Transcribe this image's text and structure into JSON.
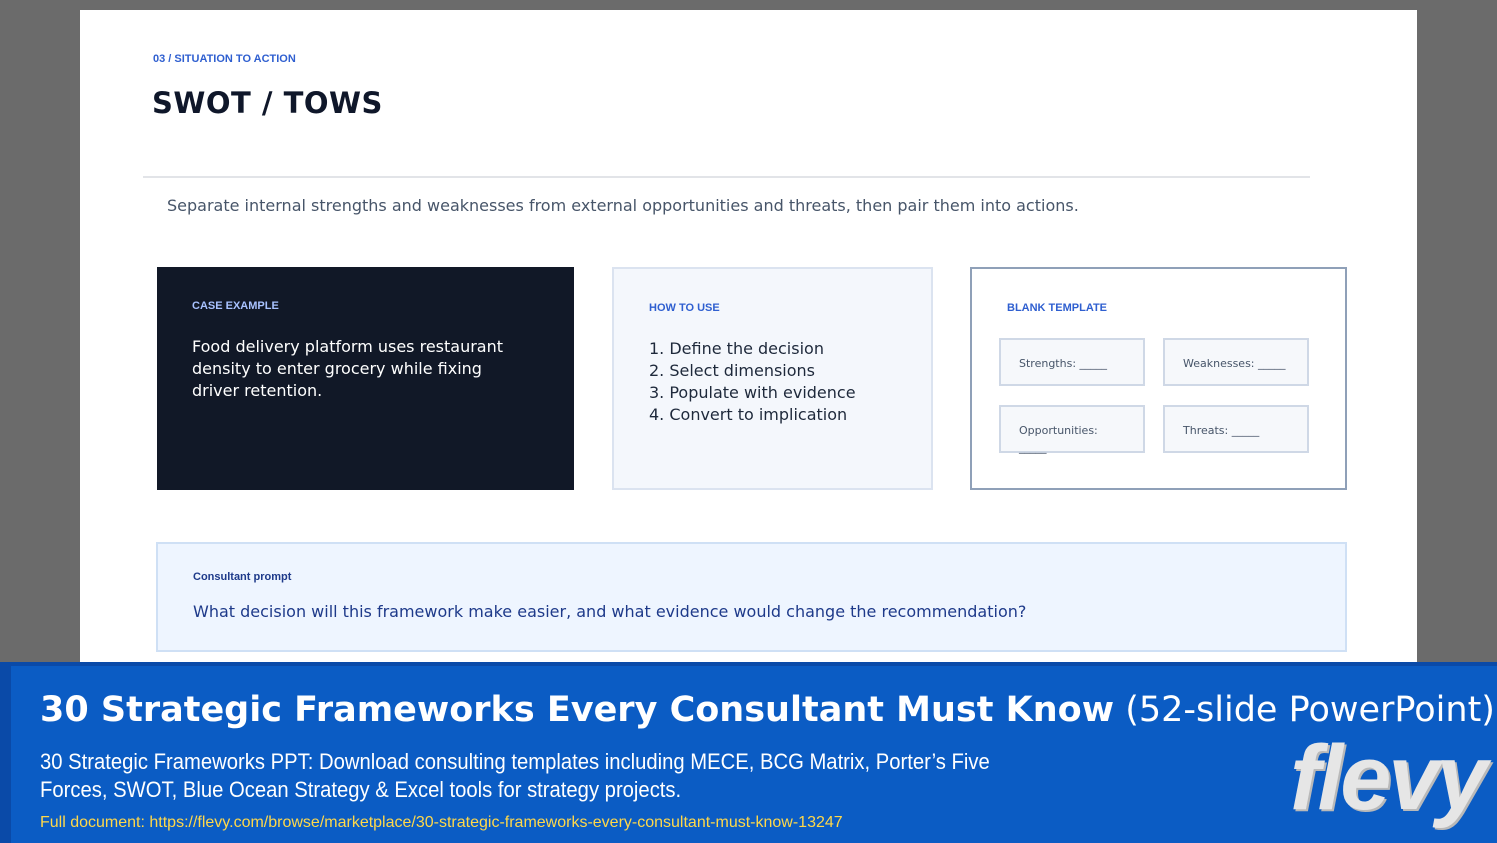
{
  "slide": {
    "kicker": "03 / SITUATION TO ACTION",
    "title": "SWOT / TOWS",
    "intro": "Separate internal strengths and weaknesses from external opportunities and threats, then pair them into actions.",
    "case": {
      "label": "CASE EXAMPLE",
      "text": "Food delivery platform uses restaurant density to enter grocery while fixing driver retention."
    },
    "how": {
      "label": "HOW TO USE",
      "steps": [
        "1. Define the decision",
        "2. Select dimensions",
        "3. Populate with evidence",
        "4. Convert to implication"
      ]
    },
    "template": {
      "label": "BLANK TEMPLATE",
      "boxes": [
        "Strengths: _____",
        "Weaknesses: _____",
        "Opportunities: _____",
        "Threats: _____"
      ]
    },
    "prompt": {
      "label": "Consultant prompt",
      "text": "What decision will this framework make easier, and what evidence would change the recommendation?"
    }
  },
  "banner": {
    "title_bold": "30 Strategic Frameworks Every Consultant Must Know",
    "title_light": "(52-slide PowerPoint)",
    "description": "30 Strategic Frameworks PPT: Download consulting templates including MECE, BCG Matrix, Porter’s Five Forces, SWOT, Blue Ocean Strategy & Excel tools for strategy projects.",
    "link": "Full document: https://flevy.com/browse/marketplace/30-strategic-frameworks-every-consultant-must-know-13247",
    "brand": "flevy"
  },
  "colors": {
    "accent": "#2f5fd0",
    "dark_card": "#111827",
    "banner": "#0b5cc4",
    "link": "#ffd84a"
  }
}
